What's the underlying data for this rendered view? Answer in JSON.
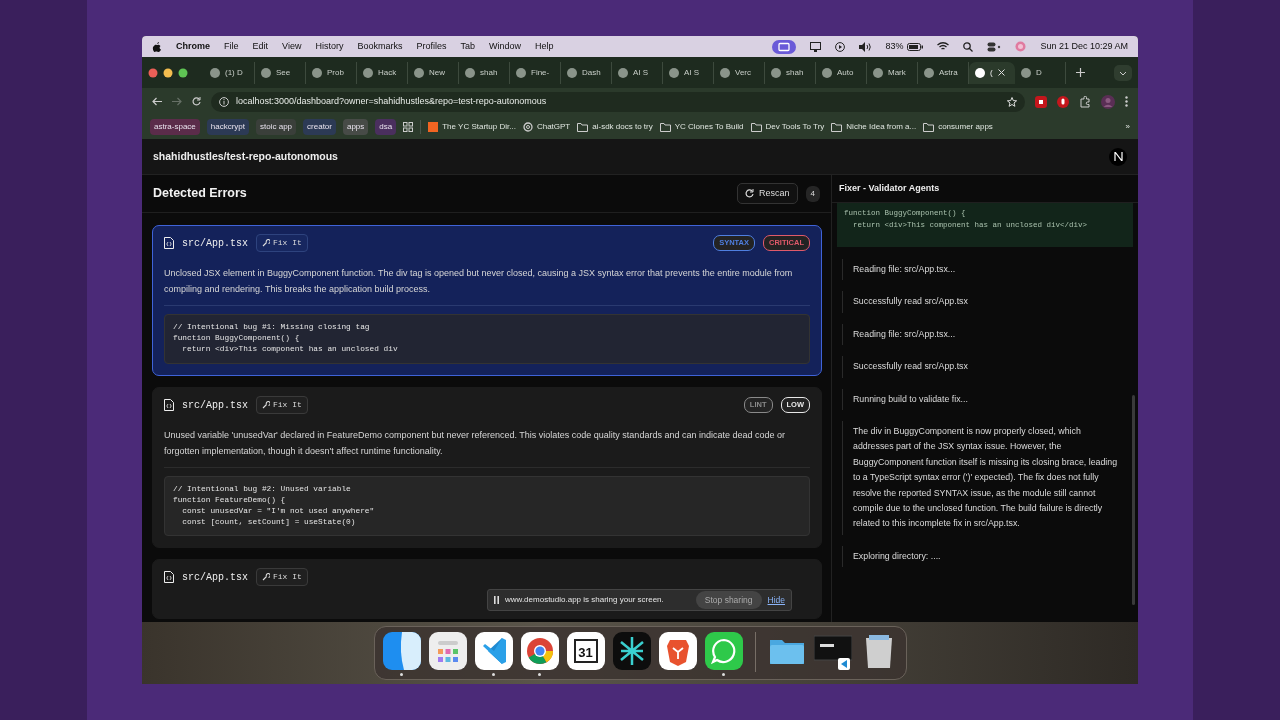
{
  "menu_bar": {
    "app": "Chrome",
    "menus": [
      "File",
      "Edit",
      "View",
      "History",
      "Bookmarks",
      "Profiles",
      "Tab",
      "Window",
      "Help"
    ],
    "battery": "83%",
    "datetime": "Sun 21 Dec  10:29 AM"
  },
  "tabs": [
    {
      "label": "(1) D",
      "selected": false
    },
    {
      "label": "See",
      "selected": false
    },
    {
      "label": "Prob",
      "selected": false
    },
    {
      "label": "Hack",
      "selected": false
    },
    {
      "label": "New",
      "selected": false
    },
    {
      "label": "shah",
      "selected": false
    },
    {
      "label": "Fine-",
      "selected": false
    },
    {
      "label": "Dash",
      "selected": false
    },
    {
      "label": "AI S",
      "selected": false
    },
    {
      "label": "AI S",
      "selected": false
    },
    {
      "label": "Verc",
      "selected": false
    },
    {
      "label": "shah",
      "selected": false
    },
    {
      "label": "Auto",
      "selected": false
    },
    {
      "label": "Mark",
      "selected": false
    },
    {
      "label": "Astra",
      "selected": false
    },
    {
      "label": "(",
      "selected": true
    },
    {
      "label": "D",
      "selected": false
    }
  ],
  "address": "localhost:3000/dashboard?owner=shahidhustles&repo=test-repo-autonomous",
  "bookmarks": [
    {
      "label": "astra-space",
      "kind": "chip",
      "color": "#5b2c4a"
    },
    {
      "label": "hackcrypt",
      "kind": "chip",
      "color": "#2c3a55"
    },
    {
      "label": "stoic app",
      "kind": "chip",
      "color": "#3a3f3a"
    },
    {
      "label": "creator",
      "kind": "chip",
      "color": "#2c3a55"
    },
    {
      "label": "apps",
      "kind": "chip",
      "color": "#474b47"
    },
    {
      "label": "dsa",
      "kind": "chip",
      "color": "#4a2f5e"
    },
    {
      "label": "The YC Startup Dir...",
      "kind": "site"
    },
    {
      "label": "ChatGPT",
      "kind": "site"
    },
    {
      "label": "ai-sdk docs to try",
      "kind": "folder"
    },
    {
      "label": "YC Clones To Build",
      "kind": "folder"
    },
    {
      "label": "Dev Tools To Try",
      "kind": "folder"
    },
    {
      "label": "Niche Idea from a...",
      "kind": "folder"
    },
    {
      "label": "consumer apps",
      "kind": "folder"
    }
  ],
  "bookmarks_more": "»",
  "page": {
    "repo": "shahidhustles/test-repo-autonomous",
    "errors_title": "Detected Errors",
    "rescan": "Rescan",
    "count": "4",
    "errors": [
      {
        "file": "src/App.tsx",
        "fix": "Fix It",
        "selected": true,
        "tags": [
          {
            "text": "SYNTAX",
            "color": "#4f7fe0"
          },
          {
            "text": "CRITICAL",
            "color": "#e05a6a"
          }
        ],
        "description": "Unclosed JSX element in BuggyComponent function. The div tag is opened but never closed, causing a JSX syntax error that prevents the entire module from compiling and rendering. This breaks the application build process.",
        "code": [
          "// Intentional bug #1: Missing closing tag",
          "function BuggyComponent() {",
          "  return <div>This component has an unclosed div"
        ]
      },
      {
        "file": "src/App.tsx",
        "fix": "Fix It",
        "selected": false,
        "tags": [
          {
            "text": "LINT",
            "color": "#8a8a8a"
          },
          {
            "text": "LOW",
            "color": "#e8e8e8"
          }
        ],
        "description": "Unused variable 'unusedVar' declared in FeatureDemo component but never referenced. This violates code quality standards and can indicate dead code or forgotten implementation, though it doesn't affect runtime functionality.",
        "code": [
          "// Intentional bug #2: Unused variable",
          "function FeatureDemo() {",
          "  const unusedVar = \"I'm not used anywhere\"",
          "  const [count, setCount] = useState(0)"
        ]
      },
      {
        "file": "src/App.tsx",
        "fix": "Fix It",
        "selected": false
      }
    ],
    "agents": {
      "title": "Fixer - Validator Agents",
      "code": [
        "function BuggyComponent() {",
        "  return <div>This component has an unclosed div</div>"
      ],
      "logs": [
        "Reading file: src/App.tsx...",
        "Successfully read src/App.tsx",
        "Reading file: src/App.tsx...",
        "Successfully read src/App.tsx",
        "Running build to validate fix...",
        "The div in BuggyComponent is now properly closed, which addresses part of the JSX syntax issue. However, the BuggyComponent function itself is missing its closing brace, leading to a TypeScript syntax error (')' expected). The fix does not fully resolve the reported SYNTAX issue, as the module still cannot compile due to the unclosed function. The build failure is directly related to this incomplete fix in src/App.tsx.",
        "Exploring directory: ...."
      ]
    }
  },
  "share_bar": {
    "message": "www.demostudio.app is sharing your screen.",
    "stop": "Stop sharing",
    "hide": "Hide"
  },
  "dock": [
    {
      "kind": "finder",
      "running": true
    },
    {
      "kind": "launcher",
      "running": false
    },
    {
      "kind": "editor",
      "running": true
    },
    {
      "kind": "browser",
      "running": true
    },
    {
      "kind": "calendar",
      "label": "31",
      "running": false
    },
    {
      "kind": "star",
      "running": false
    },
    {
      "kind": "shield",
      "running": false
    },
    {
      "kind": "chat",
      "running": true
    },
    {
      "kind": "divider"
    },
    {
      "kind": "folder",
      "running": false
    },
    {
      "kind": "window",
      "running": false
    },
    {
      "kind": "trash",
      "running": false
    }
  ]
}
